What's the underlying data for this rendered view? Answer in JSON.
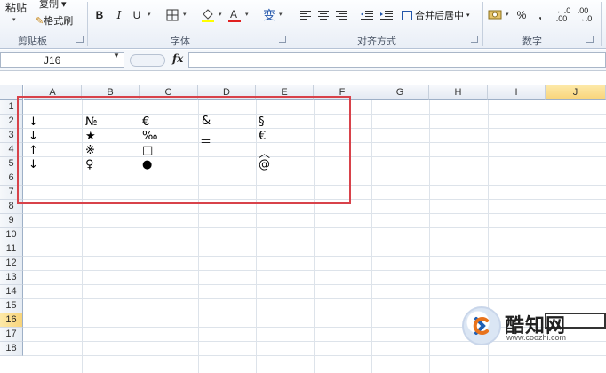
{
  "ribbon": {
    "paste_label": "粘贴",
    "copy_label": "复制",
    "format_painter_label": "格式刷",
    "clipboard_group": "剪贴板",
    "font_group": "字体",
    "bold": "B",
    "italic": "I",
    "underline": "U",
    "wen_label": "变",
    "align_group": "对齐方式",
    "merge_center_label": "合并后居中",
    "number_group": "数字",
    "percent": "%",
    "comma": ","
  },
  "formula_bar": {
    "name_box": "J16",
    "fx_label": "fx",
    "formula": ""
  },
  "sheet": {
    "columns": [
      "A",
      "B",
      "C",
      "D",
      "E",
      "F",
      "G",
      "H",
      "I",
      "J"
    ],
    "rows": [
      "1",
      "2",
      "3",
      "4",
      "5",
      "6",
      "7",
      "8",
      "9",
      "10",
      "11",
      "12",
      "13",
      "14",
      "15",
      "16",
      "17",
      "18"
    ],
    "selected_cell": "J16",
    "cells": {
      "A2": "↓",
      "B2": "№",
      "C2": "€",
      "D2": "&",
      "E2": "§",
      "A3": "↓",
      "B3": "★",
      "C3": "‰",
      "D3": "＝",
      "E3": "€",
      "A4": "↑",
      "B4": "※",
      "C4": "□",
      "E4": "︿",
      "A5": "↓",
      "B5": "♀",
      "C5": "●",
      "D5": "—",
      "E5": "@"
    }
  },
  "watermark": {
    "name": "酷知网",
    "url": "www.coozhi.com"
  },
  "colors": {
    "highlight_border": "#d8424a",
    "selected_header": "#f8d47a"
  }
}
